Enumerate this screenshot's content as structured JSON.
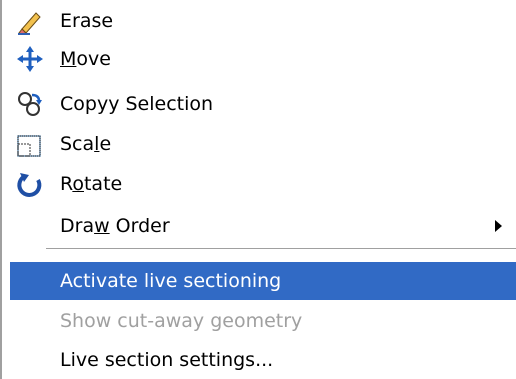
{
  "menu": {
    "items": [
      {
        "label": "Erase",
        "icon": "eraser-icon",
        "accelerator": ""
      },
      {
        "label_pre": "",
        "accel": "M",
        "label_post": "ove",
        "icon": "move-icon"
      },
      {
        "label_pre": "Copy",
        "accel": "_",
        "label_post": "Selection",
        "icon": "copy-selection-icon"
      },
      {
        "label_pre": "Sca",
        "accel": "l",
        "label_post": "e",
        "icon": "scale-icon"
      },
      {
        "label_pre": "R",
        "accel": "o",
        "label_post": "tate",
        "icon": "rotate-icon"
      },
      {
        "label_pre": "Dra",
        "accel": "w",
        "label_post": " Order",
        "icon": "",
        "submenu": true
      },
      {
        "label": "Activate live sectioning",
        "state": "highlighted"
      },
      {
        "label": "Show cut-away geometry",
        "state": "disabled"
      },
      {
        "label": "Live section settings..."
      }
    ]
  },
  "colors": {
    "highlight_bg": "#316ac5",
    "highlight_fg": "#ffffff",
    "disabled_fg": "#a0a0a0",
    "separator": "#a0a0a0"
  }
}
